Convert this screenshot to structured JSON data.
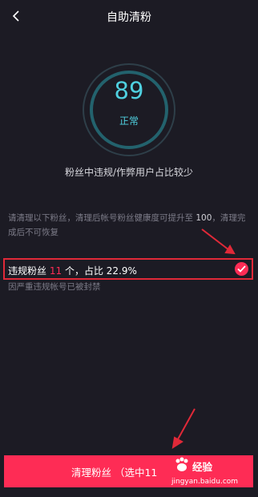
{
  "header": {
    "title": "自助清粉",
    "back_icon": "chevron-left-icon"
  },
  "gauge": {
    "score": "89",
    "status": "正常",
    "color": "#4fd0e0"
  },
  "summary": "粉丝中违规/作弊用户占比较少",
  "notice": {
    "prefix": "请清理以下粉丝，清理后帐号粉丝健康度可提升至",
    "target": "100",
    "suffix": "，清理完成后不可恢复"
  },
  "violation": {
    "label": "违规粉丝",
    "count": "11",
    "middle": "个，占比",
    "percent": "22.9%",
    "description": "因严重违规帐号已被封禁",
    "selected": true
  },
  "action_button": {
    "label": "清理粉丝 （选中11"
  },
  "watermark": {
    "text": "经验",
    "url": "jingyan.baidu.com"
  },
  "colors": {
    "accent": "#fe2c55",
    "background": "#1c1b24",
    "annotation": "#e02938"
  }
}
